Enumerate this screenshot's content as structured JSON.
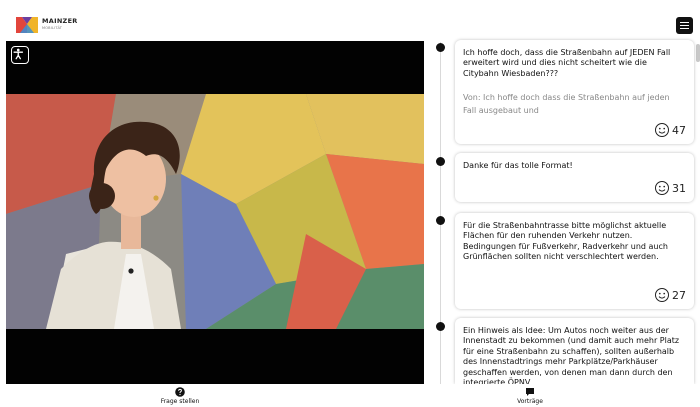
{
  "header": {
    "logo_title": "MAINZER",
    "logo_subtitle": "MOBILITÄT",
    "logo_icon": "mainz-m-logo",
    "menu_icon": "hamburger-menu-icon"
  },
  "video": {
    "accessibility_icon": "accessibility-icon"
  },
  "feed": {
    "cards": [
      {
        "text": "Ich hoffe doch, dass die Straßenbahn auf JEDEN Fall erweitert wird und dies nicht scheitert wie die Citybahn Wiesbaden???",
        "quote": "Von: Ich hoffe doch dass die Straßenbahn auf jeden Fall ausgebaut und",
        "likes": "47"
      },
      {
        "text": "Danke für das tolle Format!",
        "likes": "31"
      },
      {
        "text": "Für die Straßenbahntrasse bitte möglichst aktuelle Flächen für den ruhenden Verkehr nutzen. Bedingungen für Fußverkehr, Radverkehr und auch Grünflächen sollten nicht verschlechtert werden.",
        "likes": "27"
      },
      {
        "text": "Ein Hinweis als Idee: Um Autos noch weiter aus der Innenstadt zu bekommen (und damit auch mehr Platz für eine Straßenbahn zu schaffen), sollten außerhalb des Innenstadtrings mehr Parkplätze/Parkhäuser geschaffen werden, von denen man dann durch den integrierte ÖPNV"
      }
    ]
  },
  "bottom_nav": {
    "ask_label": "Frage stellen",
    "talks_label": "Vorträge"
  },
  "colors": {
    "accent": "#111111",
    "logo_red": "#e2453c",
    "logo_yellow": "#f0b429",
    "logo_purple": "#6b3fa0"
  }
}
